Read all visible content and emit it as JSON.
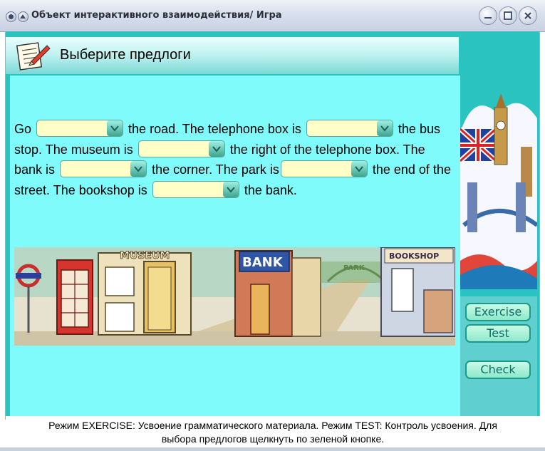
{
  "window": {
    "title": "Объект интерактивного взаимодействия/ Игра",
    "controls": [
      "minimize-icon",
      "maximize-icon",
      "close-icon"
    ]
  },
  "header": {
    "title": "Выберите предлоги",
    "icon": "notepad-pencil-icon"
  },
  "exercise": {
    "parts": {
      "p1": "Go",
      "p2": "the road. The telephone box is",
      "p3": "the bus stop. The museum is",
      "p4": "the right of the telephone box. The bank is",
      "p5": "the corner. The park is",
      "p6": "the end of the street. The bookshop is",
      "p7": "the bank."
    },
    "dropdowns": [
      {
        "id": 1,
        "value": ""
      },
      {
        "id": 2,
        "value": ""
      },
      {
        "id": 3,
        "value": ""
      },
      {
        "id": 4,
        "value": ""
      },
      {
        "id": 5,
        "value": ""
      },
      {
        "id": 6,
        "value": ""
      }
    ]
  },
  "illustration": {
    "signs": {
      "museum": "MUSEUM",
      "bank": "BANK",
      "park": "PARK",
      "bookshop": "BOOKSHOP"
    }
  },
  "side_buttons": {
    "exercise": "Exercise",
    "test": "Test",
    "check": "Check"
  },
  "status": {
    "line1": "Режим EXERCISE: Усвоение грамматического материала. Режим TEST: Контроль усвоения. Для",
    "line2": "выбора предлогов щелкнуть по зеленой кнопке."
  },
  "colors": {
    "frame": "#2bc3c0",
    "content_bg": "#7ffbfb",
    "dropdown_bg": "#ffffc8",
    "button_text": "#0e6f65"
  }
}
